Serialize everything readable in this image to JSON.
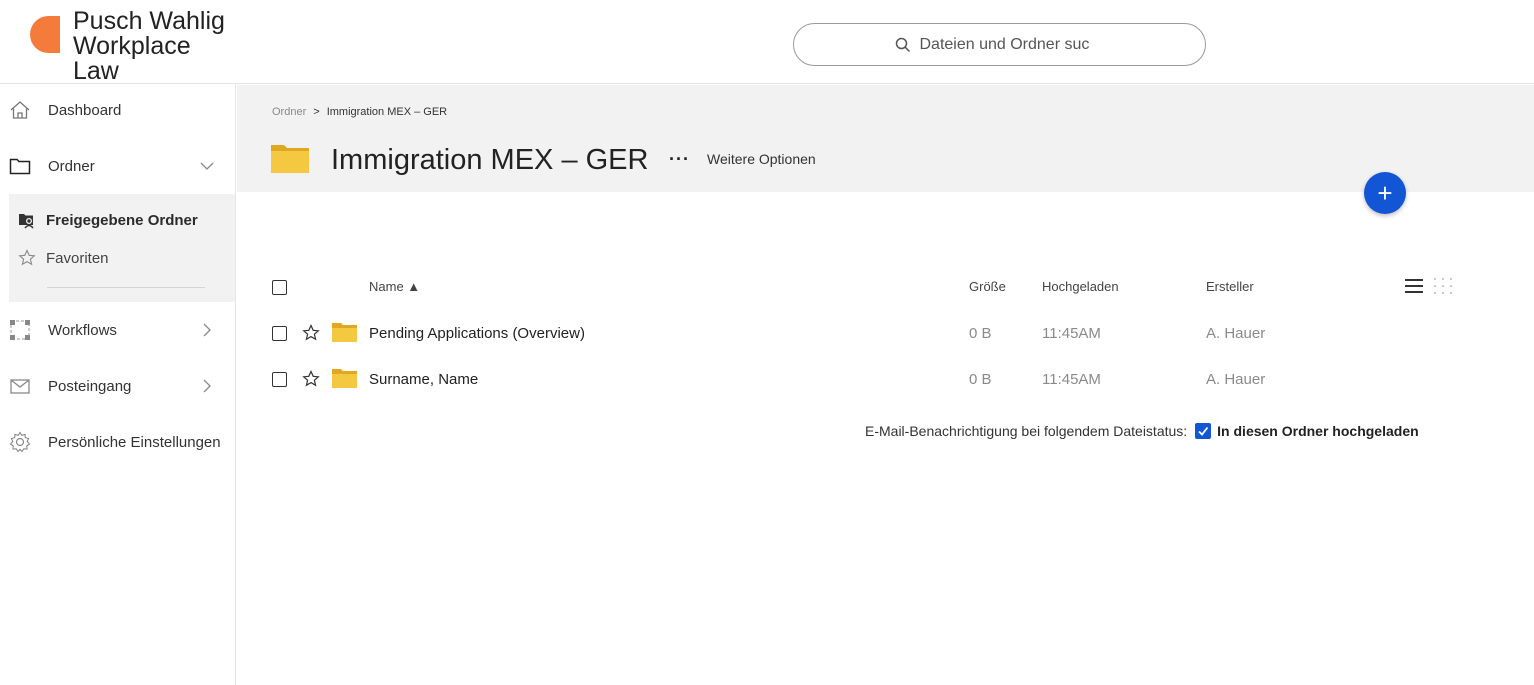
{
  "brand": {
    "lines": [
      "Pusch Wahlig",
      "Workplace",
      "Law"
    ],
    "accent_color": "#f47b3b"
  },
  "search": {
    "placeholder": "Dateien und Ordner suc",
    "icon": "search-icon"
  },
  "sidebar": {
    "dashboard": "Dashboard",
    "ordner": "Ordner",
    "shared_folders": "Freigegebene Ordner",
    "favorites": "Favoriten",
    "workflows": "Workflows",
    "inbox": "Posteingang",
    "settings": "Persönliche Einstellungen"
  },
  "breadcrumb": {
    "root": "Ordner",
    "separator": ">",
    "current": "Immigration MEX – GER"
  },
  "folder": {
    "title": "Immigration MEX – GER",
    "more_dots": "···",
    "more_label": "Weitere Optionen"
  },
  "fab": {
    "label": "+",
    "color": "#1256d6"
  },
  "table": {
    "columns": {
      "name": "Name ▲",
      "size": "Größe",
      "uploaded": "Hochgeladen",
      "creator": "Ersteller"
    },
    "rows": [
      {
        "name": "Pending Applications (Overview)",
        "size": "0 B",
        "uploaded": "11:45AM",
        "creator": "A. Hauer"
      },
      {
        "name": "Surname, Name",
        "size": "0 B",
        "uploaded": "11:45AM",
        "creator": "A. Hauer"
      }
    ]
  },
  "notification": {
    "label": "E-Mail-Benachrichtigung bei folgendem Dateistatus:",
    "option": "In diesen Ordner hochgeladen",
    "checked": true
  },
  "colors": {
    "folder": "#f5c842",
    "band": "#f2f2f2",
    "primary": "#1256d6"
  }
}
